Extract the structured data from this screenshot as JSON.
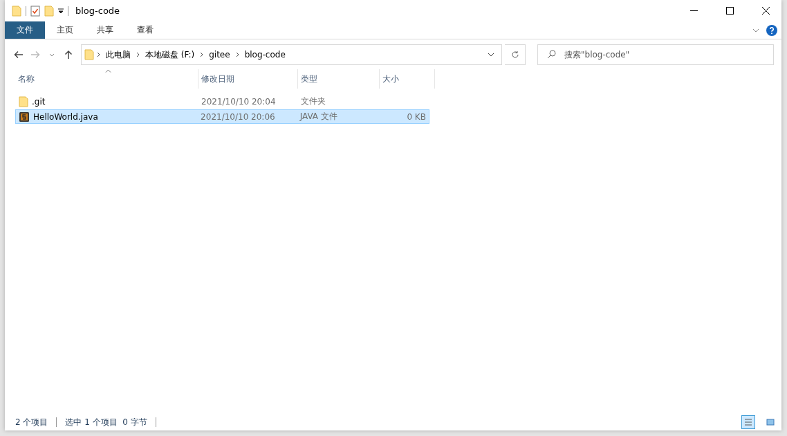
{
  "window": {
    "title": "blog-code"
  },
  "ribbon_tabs": [
    {
      "label": "文件",
      "selected": true
    },
    {
      "label": "主页",
      "selected": false
    },
    {
      "label": "共享",
      "selected": false
    },
    {
      "label": "查看",
      "selected": false
    }
  ],
  "breadcrumb": [
    "此电脑",
    "本地磁盘 (F:)",
    "gitee",
    "blog-code"
  ],
  "search": {
    "placeholder": "搜索\"blog-code\""
  },
  "columns": [
    "名称",
    "修改日期",
    "类型",
    "大小"
  ],
  "files": [
    {
      "kind": "folder",
      "name": ".git",
      "modified": "2021/10/10 20:04",
      "type": "文件夹",
      "selected": false
    },
    {
      "kind": "java",
      "name": "HelloWorld.java",
      "modified": "2021/10/10 20:06",
      "type": "JAVA 文件",
      "size": "0 KB",
      "selected": true
    }
  ],
  "status_bar": {
    "count": "2 个项目",
    "selection": "选中 1 个项目  0 字节"
  },
  "views": [
    {
      "kind": "details",
      "selected": true
    },
    {
      "kind": "large",
      "selected": false
    }
  ]
}
